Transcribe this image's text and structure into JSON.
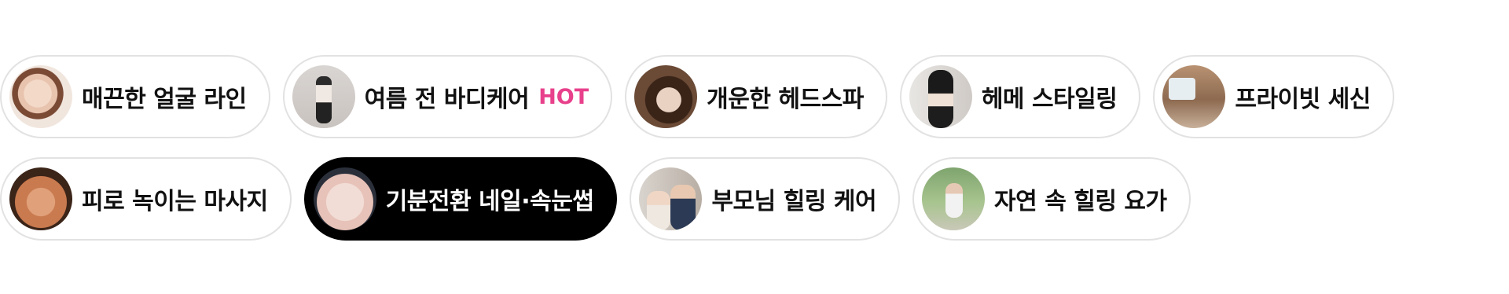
{
  "categories_row1": [
    {
      "label": "매끈한 얼굴 라인",
      "thumb": "face-photo"
    },
    {
      "label": "여름 전 바디케어",
      "thumb": "body-photo",
      "badge": "HOT"
    },
    {
      "label": "개운한 헤드스파",
      "thumb": "head-spa-photo"
    },
    {
      "label": "헤메 스타일링",
      "thumb": "styling-photo"
    },
    {
      "label": "프라이빗 세신",
      "thumb": "private-room-photo"
    }
  ],
  "categories_row2": [
    {
      "label": "피로 녹이는 마사지",
      "thumb": "massage-photo"
    },
    {
      "label": "기분전환 네일·속눈썹",
      "thumb": "nail-photo",
      "selected": true
    },
    {
      "label": "부모님 힐링 케어",
      "thumb": "parents-photo"
    },
    {
      "label": "자연 속 힐링 요가",
      "thumb": "yoga-photo"
    }
  ],
  "colors": {
    "hot_badge": "#e8408b",
    "selected_bg": "#000000",
    "chip_border": "#e2e2e2"
  }
}
